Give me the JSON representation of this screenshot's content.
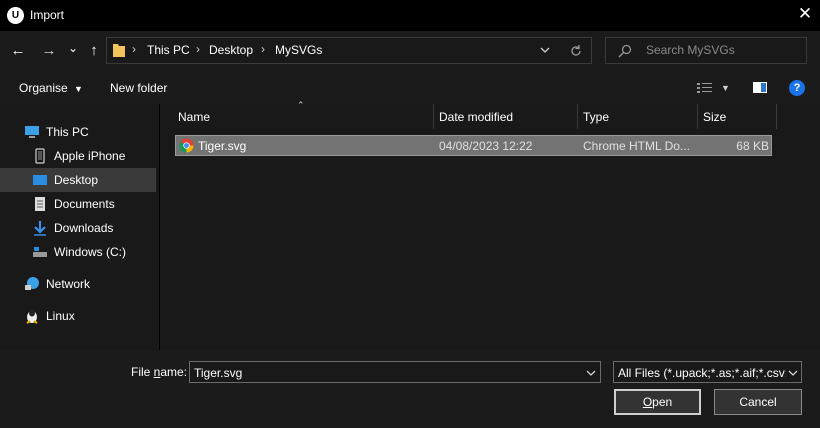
{
  "window": {
    "title": "Import",
    "logo": "U"
  },
  "nav": {
    "back_icon": "←",
    "forward_icon": "→",
    "dropdown_icon": "⌄",
    "up_icon": "↑",
    "breadcrumbs": [
      "This PC",
      "Desktop",
      "MySVGs"
    ],
    "search_placeholder": "Search MySVGs"
  },
  "toolbar": {
    "organise": "Organise",
    "new_folder": "New folder"
  },
  "sidebar": {
    "items": [
      {
        "label": "This PC",
        "icon": "pc-icon"
      },
      {
        "label": "Apple iPhone",
        "icon": "phone-icon"
      },
      {
        "label": "Desktop",
        "icon": "desktop-icon",
        "selected": true
      },
      {
        "label": "Documents",
        "icon": "documents-icon"
      },
      {
        "label": "Downloads",
        "icon": "downloads-icon"
      },
      {
        "label": "Windows (C:)",
        "icon": "drive-icon"
      },
      {
        "label": "Network",
        "icon": "network-icon"
      },
      {
        "label": "Linux",
        "icon": "linux-icon"
      }
    ]
  },
  "columns": {
    "name": "Name",
    "date": "Date modified",
    "type": "Type",
    "size": "Size"
  },
  "files": [
    {
      "name": "Tiger.svg",
      "date": "04/08/2023 12:22",
      "type": "Chrome HTML Do...",
      "size": "68 KB",
      "icon": "chrome-icon",
      "selected": true
    }
  ],
  "footer": {
    "file_name_label_pre": "File ",
    "file_name_label_u": "n",
    "file_name_label_post": "ame:",
    "file_name_value": "Tiger.svg",
    "filter": "All Files (*.upack;*.as;*.aif;*.csv;",
    "open_u": "O",
    "open_rest": "pen",
    "cancel": "Cancel"
  },
  "colors": {
    "selected_row": "#737373",
    "sidebar_selected": "#3a3a3a",
    "help": "#1a73e8"
  }
}
